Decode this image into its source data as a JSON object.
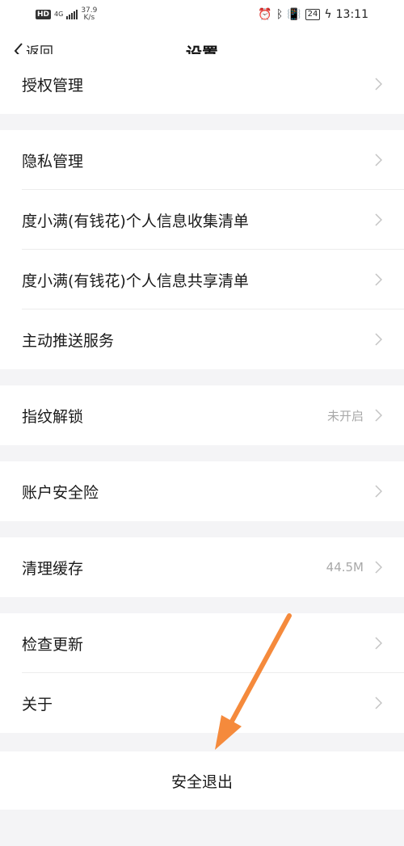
{
  "status_bar": {
    "hd": "HD",
    "signal": "4G",
    "speed_value": "37.9",
    "speed_unit": "K/s",
    "battery": "24",
    "time": "13:11"
  },
  "nav": {
    "back_label": "返回",
    "title": "设置"
  },
  "groups": [
    {
      "items": [
        {
          "label": "授权管理"
        }
      ]
    },
    {
      "items": [
        {
          "label": "隐私管理"
        },
        {
          "label": "度小满(有钱花)个人信息收集清单"
        },
        {
          "label": "度小满(有钱花)个人信息共享清单"
        },
        {
          "label": "主动推送服务"
        }
      ]
    },
    {
      "items": [
        {
          "label": "指纹解锁",
          "value": "未开启"
        }
      ]
    },
    {
      "items": [
        {
          "label": "账户安全险"
        }
      ]
    },
    {
      "items": [
        {
          "label": "清理缓存",
          "value": "44.5M"
        }
      ]
    },
    {
      "items": [
        {
          "label": "检查更新"
        },
        {
          "label": "关于"
        }
      ]
    }
  ],
  "logout_label": "安全退出",
  "annotation": {
    "arrow_color": "#f58a3c"
  }
}
